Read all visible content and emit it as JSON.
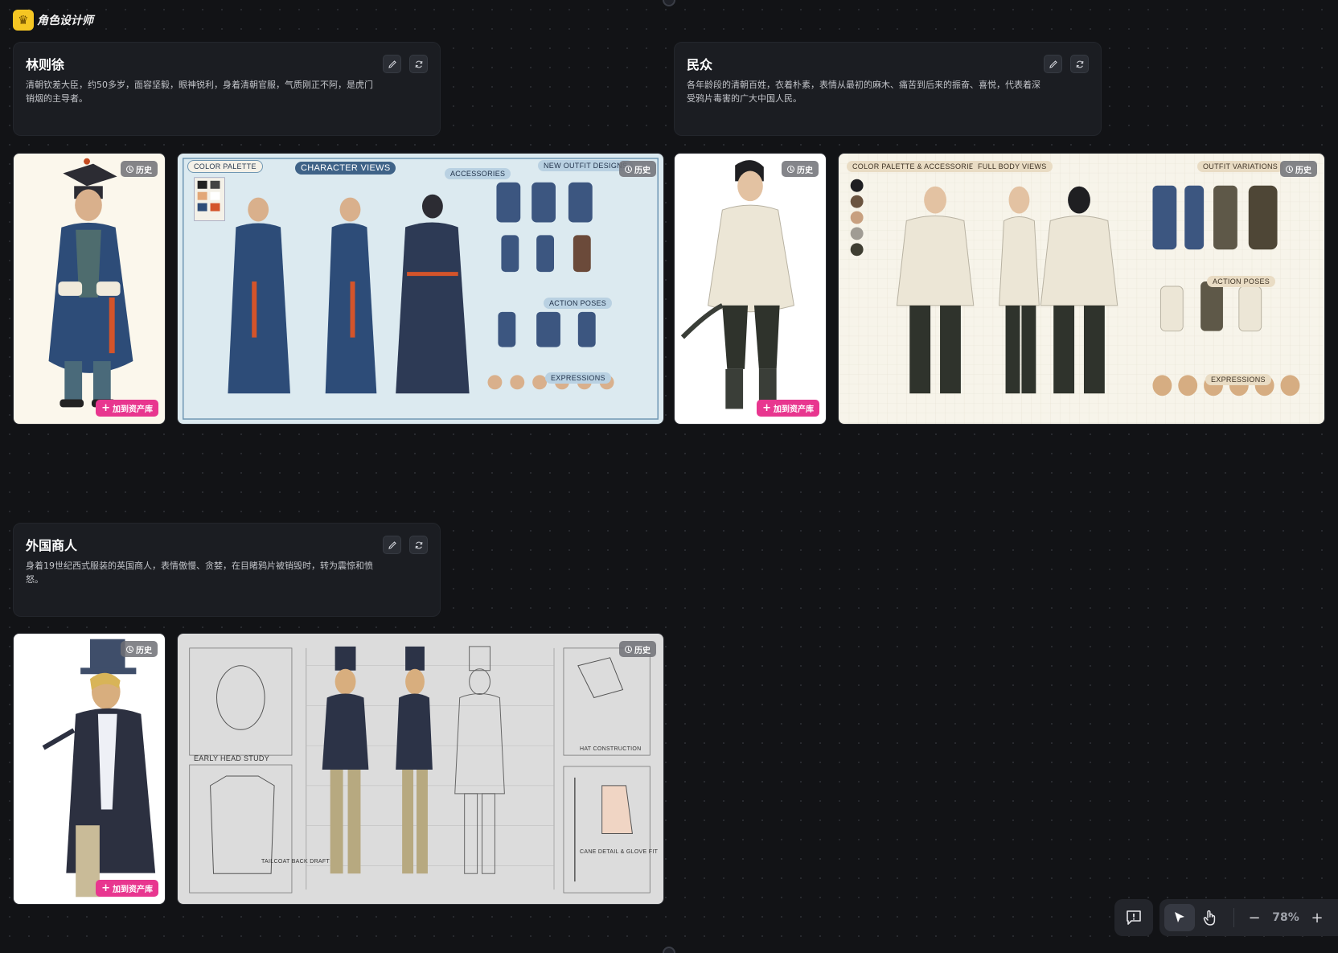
{
  "app": {
    "title": "角色设计师"
  },
  "badges": {
    "history": "历史",
    "add_to_assets": "加到资产库"
  },
  "characters": [
    {
      "name": "林则徐",
      "description": "清朝钦差大臣，约50多岁，面容坚毅，眼神锐利，身着清朝官服，气质刚正不阿，是虎门销烟的主导者。",
      "sheet_labels": {
        "palette": "COLOR PALETTE",
        "views": "CHARACTER VIEWS",
        "accessories": "ACCESSORIES",
        "outfits": "NEW OUTFIT DESIGNS",
        "poses": "ACTION POSES",
        "expressions": "EXPRESSIONS"
      }
    },
    {
      "name": "民众",
      "description": "各年龄段的清朝百姓，衣着朴素，表情从最初的麻木、痛苦到后来的振奋、喜悦，代表着深受鸦片毒害的广大中国人民。",
      "sheet_labels": {
        "palette": "COLOR PALETTE & ACCESSORIES",
        "views": "FULL BODY VIEWS",
        "outfits": "OUTFIT VARIATIONS",
        "poses": "ACTION POSES",
        "expressions": "EXPRESSIONS"
      }
    },
    {
      "name": "外国商人",
      "description": "身着19世纪西式服装的英国商人，表情傲慢、贪婪，在目睹鸦片被销毁时，转为震惊和愤怒。",
      "sheet_labels": {
        "head": "EARLY HEAD STUDY",
        "tailcoat": "TAILCOAT BACK DRAFT",
        "hat": "HAT CONSTRUCTION",
        "cane": "CANE DETAIL & GLOVE FIT"
      }
    }
  ],
  "toolbar": {
    "zoom": "78%",
    "zoom_out": "−",
    "zoom_in": "+"
  },
  "colors": {
    "background": "#121316",
    "card": "#1b1d22",
    "accent_pink": "#e8368f",
    "logo_yellow": "#f5c623"
  }
}
